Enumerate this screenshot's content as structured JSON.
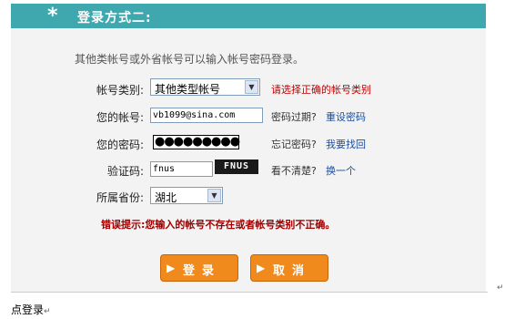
{
  "header": {
    "star": "*",
    "title": "登录方式二:"
  },
  "intro": "其他类帐号或外省帐号可以输入帐号密码登录。",
  "form": {
    "account_type": {
      "label": "帐号类别:",
      "value": "其他类型帐号",
      "hint": "请选择正确的帐号类别"
    },
    "account": {
      "label": "您的帐号:",
      "value": "vb1099@sina.com",
      "note": "密码过期?",
      "link": "重设密码"
    },
    "password": {
      "label": "您的密码:",
      "value": "●●●●●●●●●",
      "note": "忘记密码?",
      "link": "我要找回"
    },
    "captcha": {
      "label": "验证码:",
      "value": "fnus",
      "image_text": "FNUS",
      "note": "看不清楚?",
      "link": "换一个"
    },
    "province": {
      "label": "所属省份:",
      "value": "湖北"
    }
  },
  "error": "错误提示:您输入的帐号不存在或者帐号类别不正确。",
  "buttons": {
    "login": "登录",
    "cancel": "取消"
  },
  "footer": {
    "text": "点登录",
    "return_mark": "↵"
  },
  "colors": {
    "header": "#3fa7ae",
    "button": "#f08a1c",
    "error": "#a00000",
    "link": "#1c4e9c"
  }
}
